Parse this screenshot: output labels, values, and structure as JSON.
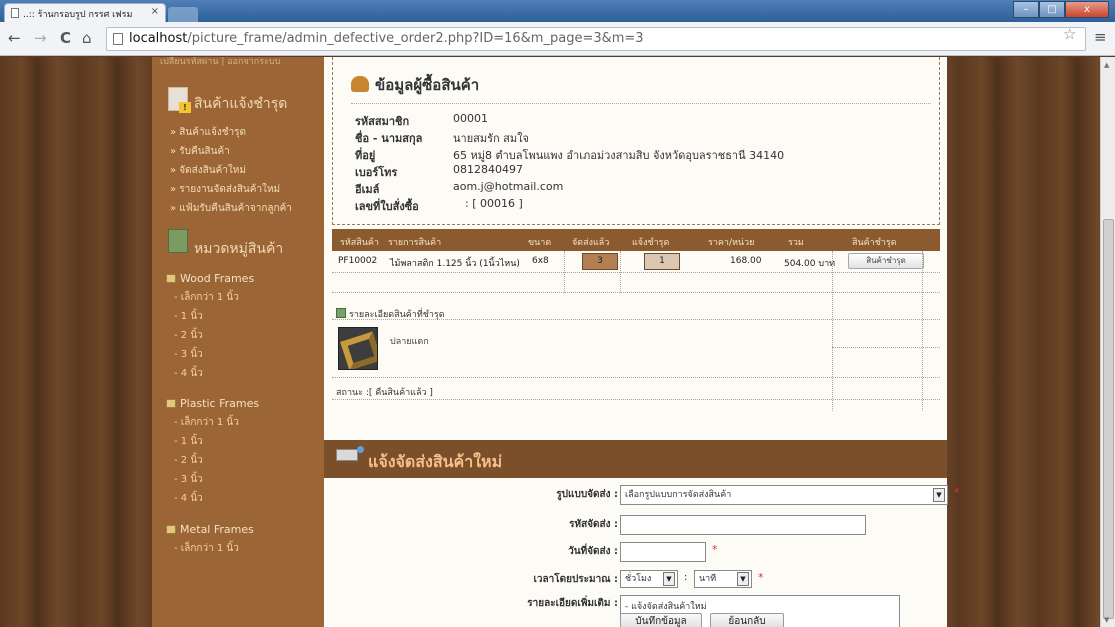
{
  "browser": {
    "tab_title": "..:: ร้านกรอบรูป กรรศ เฟรม",
    "tab_close": "×",
    "url_host": "localhost",
    "url_path": "/picture_frame/admin_defective_order2.php?ID=16&m_page=3&m=3",
    "back": "←",
    "forward": "→",
    "reload": "C",
    "home": "⌂",
    "bookmark": "☆",
    "menu": "≡",
    "minimize": "–",
    "maximize": "□",
    "close": "x"
  },
  "sidebar": {
    "top_links": "เปลี่ยนรหัสผ่าน | ออกจากระบบ",
    "section1_title": "สินค้าแจ้งชำรุด",
    "section1_items": [
      "สินค้าแจ้งชำรุด",
      "รับคืนสินค้า",
      "จัดส่งสินค้าใหม่",
      "รายงานจัดส่งสินค้าใหม่",
      "แฟ้มรับคืนสินค้าจากลูกค้า"
    ],
    "section2_title": "หมวดหมู่สินค้า",
    "categories": [
      {
        "name": "Wood Frames",
        "subs": [
          "เล็กกว่า 1 นิ้ว",
          "1 นิ้ว",
          "2 นิ้ว",
          "3 นิ้ว",
          "4 นิ้ว"
        ]
      },
      {
        "name": "Plastic Frames",
        "subs": [
          "เล็กกว่า 1 นิ้ว",
          "1 นิ้ว",
          "2 นิ้ว",
          "3 นิ้ว",
          "4 นิ้ว"
        ]
      },
      {
        "name": "Metal Frames",
        "subs": [
          "เล็กกว่า 1 นิ้ว"
        ]
      }
    ]
  },
  "customer": {
    "title": "ข้อมูลผู้ซื้อสินค้า",
    "fields": [
      {
        "label": "รหัสสมาชิก",
        "value": "00001"
      },
      {
        "label": "ชื่อ - นามสกุล",
        "value": "นายสมรัก สมใจ"
      },
      {
        "label": "ที่อยู่",
        "value": "65 หมู่8 ตำบลโพนแพง อำเภอม่วงสามสิบ จังหวัดอุบลราชธานี 34140"
      },
      {
        "label": "เบอร์โทร",
        "value": "0812840497"
      },
      {
        "label": "อีเมล์",
        "value": "aom.j@hotmail.com"
      },
      {
        "label": "เลขที่ใบสั่งซื้อ",
        "value": ": [ 00016 ]"
      }
    ]
  },
  "order_table": {
    "headers": [
      "รหัสสินค้า",
      "รายการสินค้า",
      "ขนาด",
      "จัดส่งแล้ว",
      "แจ้งชำรุด",
      "ราคา/หน่วย",
      "รวม",
      "สินค้าชำรุด"
    ],
    "row": {
      "code": "PF10002",
      "name": "ไม้พลาสติก 1.125 นิ้ว (1นิ้วไหน)",
      "size": "6x8",
      "shipped": "3",
      "defective": "1",
      "unit_price": "168.00",
      "total": "504.00 บาท",
      "action": "สินค้าชำรุด"
    },
    "detail_title": "รายละเอียดสินค้าที่ชำรุด",
    "detail_text": "ปลายแตก",
    "status": "สถานะ :[ คืนสินค้าแล้ว ]"
  },
  "ship_form": {
    "title": "แจ้งจัดส่งสินค้าใหม่",
    "method_label": "รูปแบบจัดส่ง :",
    "method_value": "เลือกรูปแบบการจัดส่งสินค้า",
    "tracking_label": "รหัสจัดส่ง :",
    "date_label": "วันที่จัดส่ง :",
    "time_label": "เวลาโดยประมาณ :",
    "hour_value": "ชั่วโมง",
    "minute_sep": ":",
    "minute_value": "นาที",
    "notes_label": "รายละเอียดเพิ่มเติม :",
    "notes_value": "- แจ้งจัดส่งสินค้าใหม่",
    "required_mark": "*",
    "save_button": "บันทึกข้อมูล",
    "back_button": "ย้อนกลับ"
  }
}
